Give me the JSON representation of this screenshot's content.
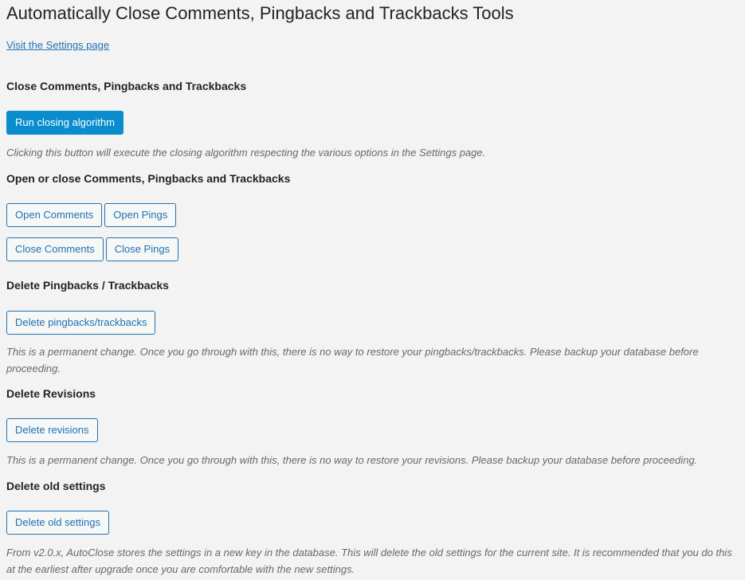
{
  "page": {
    "title": "Automatically Close Comments, Pingbacks and Trackbacks Tools",
    "settings_link": "Visit the Settings page"
  },
  "sections": {
    "close": {
      "title": "Close Comments, Pingbacks and Trackbacks",
      "button": "Run closing algorithm",
      "description": "Clicking this button will execute the closing algorithm respecting the various options in the Settings page."
    },
    "open_close": {
      "title": "Open or close Comments, Pingbacks and Trackbacks",
      "open_comments": "Open Comments",
      "open_pings": "Open Pings",
      "close_comments": "Close Comments",
      "close_pings": "Close Pings"
    },
    "delete_pingbacks": {
      "title": "Delete Pingbacks / Trackbacks",
      "button": "Delete pingbacks/trackbacks",
      "description": "This is a permanent change. Once you go through with this, there is no way to restore your pingbacks/trackbacks. Please backup your database before proceeding."
    },
    "delete_revisions": {
      "title": "Delete Revisions",
      "button": "Delete revisions",
      "description": "This is a permanent change. Once you go through with this, there is no way to restore your revisions. Please backup your database before proceeding."
    },
    "delete_old_settings": {
      "title": "Delete old settings",
      "button": "Delete old settings",
      "description": "From v2.0.x, AutoClose stores the settings in a new key in the database. This will delete the old settings for the current site. It is recommended that you do this at the earliest after upgrade once you are comfortable with the new settings."
    }
  },
  "colors": {
    "background": "#f3f3f3",
    "primary_button": "#0a8dcc",
    "link": "#2271b1",
    "description_text": "#646970"
  }
}
